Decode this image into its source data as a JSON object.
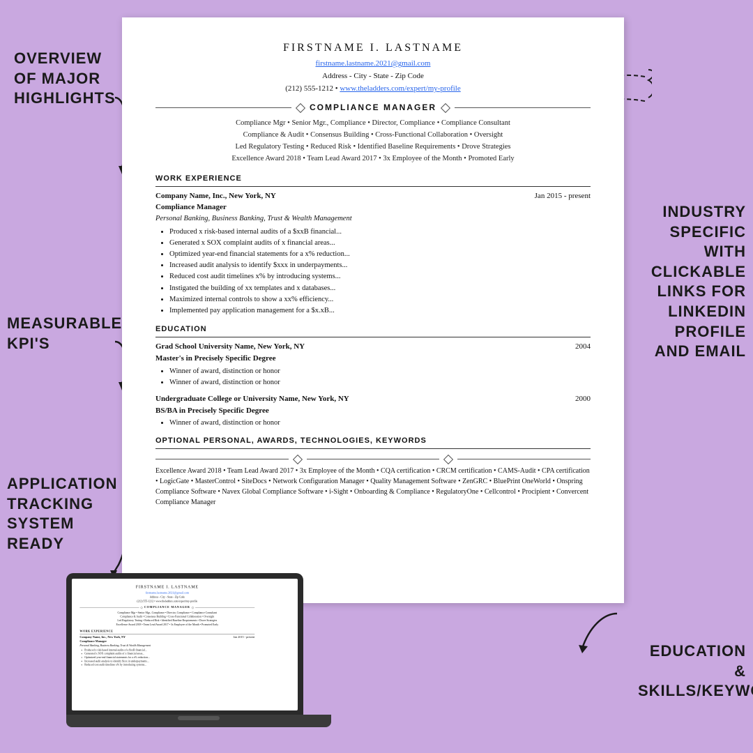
{
  "background_color": "#c9a8e0",
  "annotations": {
    "overview": "OVERVIEW\nOF MAJOR\nHIGHLIGHTS",
    "measurable": "MEASURABLE\nKPI'S",
    "ats": "APPLICATION\nTRACKING\nSYSTEM\nREADY",
    "industry": "INDUSTRY\nSPECIFIC\nWITH\nCLICKABLE\nLINKS FOR\nLINKEDIN\nPROFILE\nAND EMAIL",
    "education": "EDUCATION &\nSKILLS/KEYWORDS"
  },
  "resume": {
    "name": "FIRSTNAME I. LASTNAME",
    "email": "firstname.lastname.2021@gmail.com",
    "address": "Address - City - State - Zip Code",
    "phone_linkedin": "(212) 555-1212 • www.theladders.com/expert/my-profile",
    "title": "COMPLIANCE MANAGER",
    "keywords_line1": "Compliance Mgr • Senior Mgr., Compliance • Director, Compliance • Compliance Consultant",
    "keywords_line2": "Compliance & Audit • Consensus Building • Cross-Functional Collaboration • Oversight",
    "keywords_line3": "Led Regulatory Testing • Reduced Risk • Identified Baseline Requirements • Drove Strategies",
    "keywords_line4": "Excellence Award 2018 • Team Lead Award 2017 • 3x Employee of the Month • Promoted Early",
    "work_experience_header": "WORK EXPERIENCE",
    "job1": {
      "company": "Company Name, Inc., New York, NY",
      "date": "Jan 2015 - present",
      "title": "Compliance Manager",
      "subtitle": "Personal Banking, Business Banking, Trust & Wealth Management",
      "bullets": [
        "Produced x risk-based internal audits of a $xxB financial...",
        "Generated x SOX complaint audits of x financial areas...",
        "Optimized year-end financial statements for a x% reduction...",
        "Increased audit analysis to identify $xxx in underpayments...",
        "Reduced cost audit timelines x% by introducing systems...",
        "Instigated the building of xx templates and x databases...",
        "Maximized internal controls to show a xx% efficiency...",
        "Implemented pay application management for a $x.xB..."
      ]
    },
    "education_header": "EDUCATION",
    "edu1": {
      "school": "Grad School University Name, New York, NY",
      "year": "2004",
      "degree": "Master's in Precisely Specific Degree",
      "bullets": [
        "Winner of award, distinction or honor",
        "Winner of award, distinction or honor"
      ]
    },
    "edu2": {
      "school": "Undergraduate College or University Name, New York, NY",
      "year": "2000",
      "degree": "BS/BA in Precisely Specific Degree",
      "bullets": [
        "Winner of award, distinction or honor"
      ]
    },
    "optional_header": "OPTIONAL PERSONAL, AWARDS, TECHNOLOGIES, KEYWORDS",
    "optional_content": "Excellence Award 2018 • Team Lead Award 2017 • 3x Employee of the Month • CQA certification • CRCM certification • CAMS-Audit • CPA certification • LogicGate • MasterControl • SiteDocs • Network Configuration Manager • Quality Management Software • ZenGRC • BluePrint OneWorld • Onspring Compliance Software • Navex Global Compliance Software • i-Sight • Onboarding & Compliance • RegulatoryOne • Cellcontrol • Procipient • Convercent Compliance Manager"
  }
}
